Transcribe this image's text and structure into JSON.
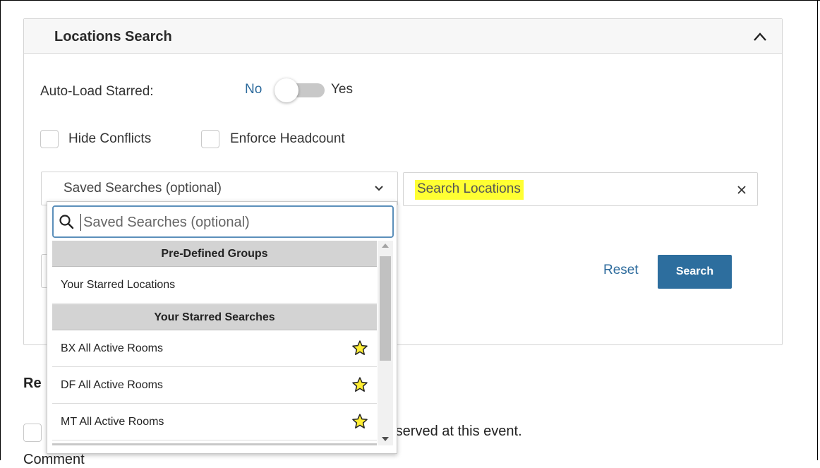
{
  "panel": {
    "title": "Locations Search"
  },
  "auto_load": {
    "label": "Auto-Load Starred:",
    "no_label": "No",
    "yes_label": "Yes",
    "value": "No"
  },
  "options": {
    "hide_conflicts": "Hide Conflicts",
    "enforce_headcount": "Enforce Headcount"
  },
  "saved_searches": {
    "selected": "Saved Searches (optional)",
    "filter_placeholder": "Saved Searches (optional)"
  },
  "location_search": {
    "value": "Search Locations"
  },
  "actions": {
    "reset_label": "Reset",
    "search_label": "Search"
  },
  "dropdown": {
    "groups": [
      {
        "label": "Pre-Defined Groups"
      },
      {
        "label": "Your Starred Searches"
      }
    ],
    "items": [
      {
        "label": "Your Starred Locations",
        "starred": false
      },
      {
        "label": "BX All Active Rooms",
        "starred": true,
        "star_icon": "star-icon"
      },
      {
        "label": "DF All Active Rooms",
        "starred": true,
        "star_icon": "star-icon"
      },
      {
        "label": "MT All Active Rooms",
        "starred": true,
        "star_icon": "star-icon"
      }
    ]
  },
  "below": {
    "heading": "Re",
    "text": "e served at this event.",
    "comment": "Comment"
  },
  "colors": {
    "accent": "#2d6e9e",
    "link": "#2c6a9c",
    "highlight": "#ffff33",
    "star_fill": "#ffee33"
  }
}
